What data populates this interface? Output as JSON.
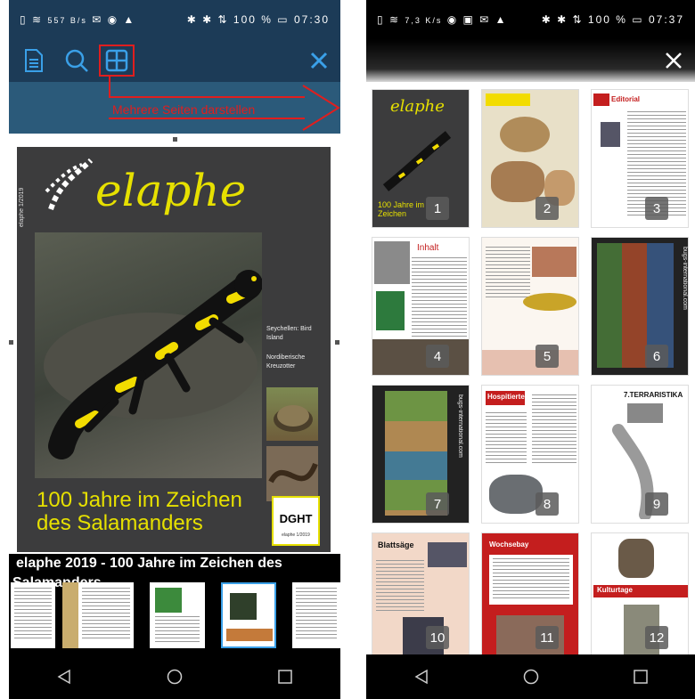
{
  "left_screen": {
    "status": {
      "network": "557 B/s",
      "battery": "100 %",
      "time": "07:30"
    },
    "annotation_label": "Mehrere Seiten darstellen",
    "cover": {
      "masthead": "elaphe",
      "spine": "elaphe 1/2019",
      "headline_line1": "100 Jahre im Zeichen",
      "headline_line2": "des Salamanders",
      "side_text1": "Seychellen: Bird Island",
      "side_text2": "Nordiberische Kreuzotter",
      "badge": "DGHT",
      "badge_sub": "elaphe 1/2019"
    },
    "doc_title": "elaphe 2019 - 100 Jahre im Zeichen des",
    "doc_title_cont": "Salamanders"
  },
  "right_screen": {
    "status": {
      "network": "7,3 K/s",
      "battery": "100 %",
      "time": "07:37"
    },
    "pages": [
      {
        "num": "1"
      },
      {
        "num": "2"
      },
      {
        "num": "3"
      },
      {
        "num": "4"
      },
      {
        "num": "5"
      },
      {
        "num": "6"
      },
      {
        "num": "7"
      },
      {
        "num": "8"
      },
      {
        "num": "9"
      },
      {
        "num": "10"
      },
      {
        "num": "11"
      },
      {
        "num": "12"
      }
    ],
    "page_texts": {
      "p3_heading": "Editorial",
      "p4_heading": "Inhalt",
      "p6_side": "bugs-international.com",
      "p7_side": "bugs-international.com",
      "p8_heading": "Hospitierte",
      "p9_heading": "7.TERRARISTIKA",
      "p10_heading": "Blattsäge",
      "p11_heading": "Wochsebay",
      "p12_heading": "Kulturtage"
    }
  },
  "colors": {
    "toolbar": "#1c3b57",
    "accent_red": "#e01e1e",
    "cover_bg": "#3c3c3d",
    "cover_yellow": "#e6e000"
  }
}
